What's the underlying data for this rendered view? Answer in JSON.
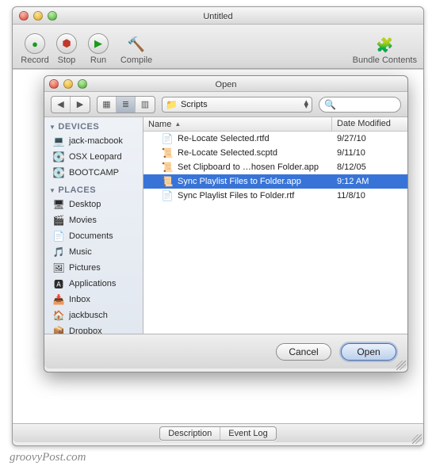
{
  "main_window": {
    "title": "Untitled",
    "toolbar": {
      "record": "Record",
      "stop": "Stop",
      "run": "Run",
      "compile": "Compile",
      "bundle": "Bundle Contents"
    },
    "bottom_tabs": {
      "description": "Description",
      "event_log": "Event Log"
    }
  },
  "dialog": {
    "title": "Open",
    "path_label": "Scripts",
    "search_placeholder": "",
    "columns": {
      "name": "Name",
      "date": "Date Modified"
    },
    "sidebar": {
      "devices_header": "DEVICES",
      "devices": [
        {
          "label": "jack-macbook",
          "icon": "💻"
        },
        {
          "label": "OSX Leopard",
          "icon": "💽"
        },
        {
          "label": "BOOTCAMP",
          "icon": "💽"
        }
      ],
      "places_header": "PLACES",
      "places": [
        {
          "label": "Desktop",
          "icon": "🖥"
        },
        {
          "label": "Movies",
          "icon": "🎬"
        },
        {
          "label": "Documents",
          "icon": "📄"
        },
        {
          "label": "Music",
          "icon": "🎵"
        },
        {
          "label": "Pictures",
          "icon": "🖼"
        },
        {
          "label": "Applications",
          "icon": "🅰"
        },
        {
          "label": "Inbox",
          "icon": "📥"
        },
        {
          "label": "jackbusch",
          "icon": "🏠"
        },
        {
          "label": "Dropbox",
          "icon": "📦"
        }
      ]
    },
    "files": [
      {
        "name": "Re-Locate Selected.rtfd",
        "date": "9/27/10",
        "icon": "📄",
        "selected": false
      },
      {
        "name": "Re-Locate Selected.scptd",
        "date": "9/11/10",
        "icon": "📜",
        "selected": false
      },
      {
        "name": "Set Clipboard to …hosen Folder.app",
        "date": "8/12/05",
        "icon": "📜",
        "selected": false
      },
      {
        "name": "Sync Playlist Files to Folder.app",
        "date": "9:12 AM",
        "icon": "📜",
        "selected": true
      },
      {
        "name": "Sync Playlist Files to Folder.rtf",
        "date": "11/8/10",
        "icon": "📄",
        "selected": false
      }
    ],
    "buttons": {
      "cancel": "Cancel",
      "open": "Open"
    }
  },
  "watermark": "groovyPost.com"
}
